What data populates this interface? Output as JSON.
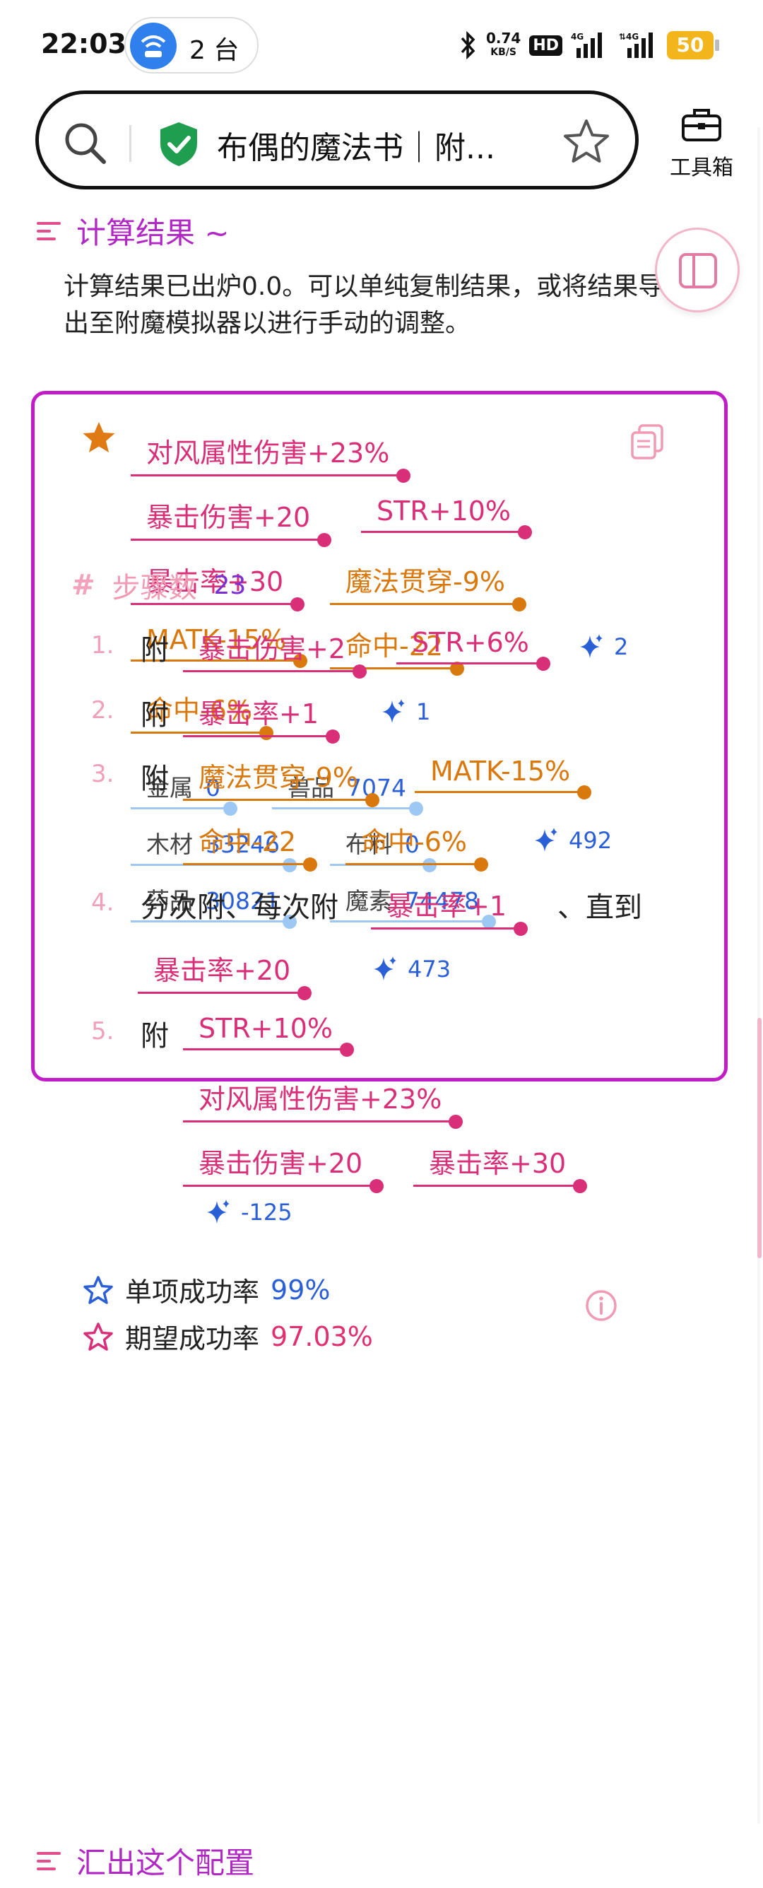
{
  "status_bar": {
    "time": "22:03",
    "device_count": "2 台",
    "net_speed_value": "0.74",
    "net_speed_unit": "KB/S",
    "hd_badge": "HD",
    "battery": "50"
  },
  "browser": {
    "page_title": "布偶的魔法书｜附...",
    "tools_label": "工具箱"
  },
  "result_section": {
    "title": "计算结果 ~",
    "intro": "计算结果已出炉0.0。可以单纯复制结果，或将结果导出至附魔模拟器以进行手动的调整。"
  },
  "result_card": {
    "tags": [
      {
        "text": "对风属性伤害+23%",
        "color": "pink"
      },
      {
        "text": "暴击伤害+20",
        "color": "pink"
      },
      {
        "text": "STR+10%",
        "color": "pink"
      },
      {
        "text": "暴击率+30",
        "color": "pink"
      },
      {
        "text": "魔法贯穿-9%",
        "color": "orange"
      },
      {
        "text": "MATK-15%",
        "color": "orange"
      },
      {
        "text": "命中-22",
        "color": "orange"
      },
      {
        "text": "命中-6%",
        "color": "orange"
      }
    ],
    "materials": [
      {
        "name": "金属",
        "value": "0"
      },
      {
        "name": "兽品",
        "value": "7074"
      },
      {
        "name": "木材",
        "value": "33246"
      },
      {
        "name": "布料",
        "value": "0"
      },
      {
        "name": "药品",
        "value": "30821"
      },
      {
        "name": "魔素",
        "value": "74478"
      }
    ],
    "steps_label": "步骤数",
    "steps_count": "23",
    "steps": [
      {
        "num": "1.",
        "word": "附",
        "tags": [
          "暴击伤害+2",
          "STR+6%"
        ],
        "potential": "2"
      },
      {
        "num": "2.",
        "word": "附",
        "tags": [
          "暴击率+1"
        ],
        "potential": "1"
      },
      {
        "num": "3.",
        "word": "附",
        "tags": [
          "魔法贯穿-9%",
          "MATK-15%",
          "命中-22",
          "命中-6%"
        ],
        "potential": "492"
      },
      {
        "num": "4.",
        "word": "分次附、每次附",
        "tags": [
          "暴击率+1",
          "暴击率+20"
        ],
        "suffix": "、直到",
        "potential": "473"
      },
      {
        "num": "5.",
        "word": "附",
        "tags": [
          "STR+10%",
          "对风属性伤害+23%",
          "暴击伤害+20",
          "暴击率+30"
        ],
        "potential": "-125"
      }
    ],
    "single_rate_label": "单项成功率",
    "single_rate_value": "99%",
    "expected_rate_label": "期望成功率",
    "expected_rate_value": "97.03%"
  },
  "export_section": {
    "title": "汇出这个配置"
  },
  "colors": {
    "card_border": "#c21cc9",
    "pink": "#d92f78",
    "orange": "#d9780c",
    "material_line": "#9cc8f3",
    "value_blue": "#2a5fd6",
    "section_title": "#b128c4"
  }
}
